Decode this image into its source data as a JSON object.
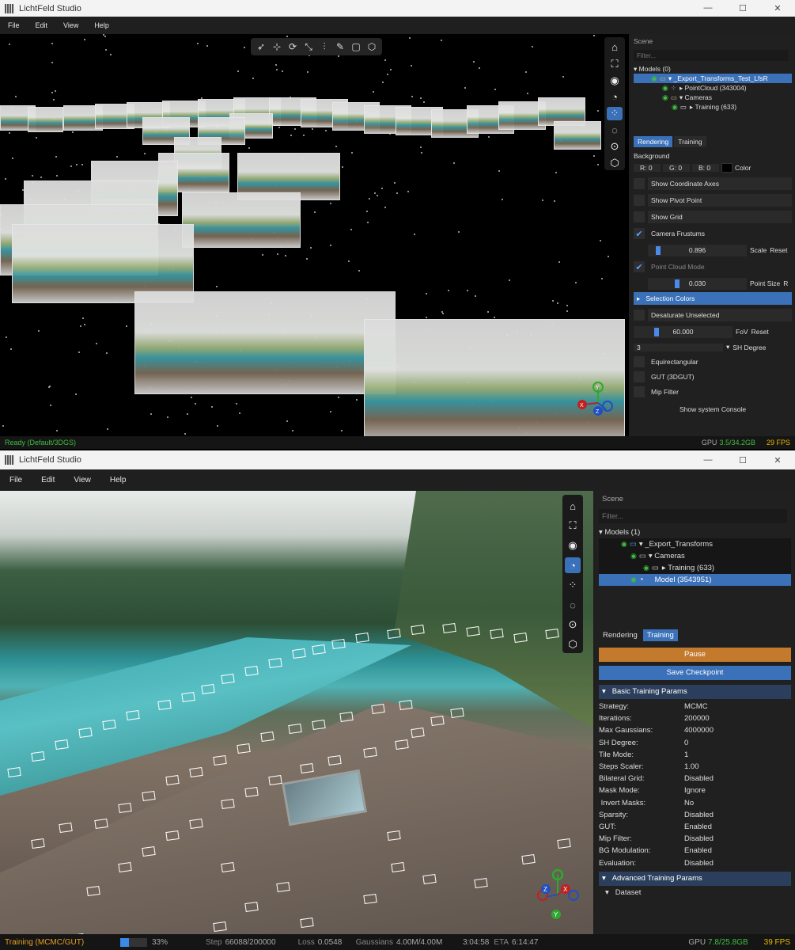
{
  "top": {
    "title": "LichtFeld Studio",
    "window_controls": [
      "—",
      "☐",
      "✕"
    ],
    "menu": [
      "File",
      "Edit",
      "View",
      "Help"
    ],
    "toolbar_icons": [
      "pointer-icon",
      "translate-icon",
      "rotate-icon",
      "scale-icon",
      "mirror-icon",
      "brush-icon",
      "crop-icon",
      "cube-icon"
    ],
    "side_icons": [
      "home-icon",
      "fit-icon",
      "eye-icon",
      "splat-icon",
      "points-icon",
      "select-circle-icon",
      "select-dashed-icon",
      "cube-icon"
    ],
    "scene": {
      "title": "Scene",
      "filter_placeholder": "Filter...",
      "models_label": "Models (0)",
      "tree": [
        {
          "label": "_Export_Transforms_Test_LfsR"
        },
        {
          "label": "PointCloud  (343004)"
        },
        {
          "label": "Cameras"
        },
        {
          "label": "Training (633)"
        }
      ]
    },
    "tabs": [
      "Rendering",
      "Training"
    ],
    "background_label": "Background",
    "rgb": [
      "R: 0",
      "G: 0",
      "B: 0"
    ],
    "color_label": "Color",
    "options": [
      {
        "label": "Show Coordinate Axes",
        "checked": false
      },
      {
        "label": "Show Pivot Point",
        "checked": false
      },
      {
        "label": "Show Grid",
        "checked": false
      },
      {
        "label": "Camera Frustums",
        "checked": true
      }
    ],
    "scale_value": "0.896",
    "scale_label": "Scale",
    "reset_label": "Reset",
    "point_cloud_mode": "Point Cloud Mode",
    "point_size_value": "0.030",
    "point_size_label": "Point Size",
    "point_size_reset": "R",
    "selection_colors": "Selection Colors",
    "desaturate": "Desaturate Unselected",
    "fov_value": "60.000",
    "fov_label": "FoV",
    "fov_reset": "Reset",
    "sh_value": "3",
    "sh_label": "SH Degree",
    "options2": [
      "Equirectangular",
      "GUT (3DGUT)",
      "Mip Filter"
    ],
    "console_btn": "Show system Console",
    "status_left": "Ready (Default/3DGS)",
    "gpu_label": "GPU",
    "gpu_value": "3.5/34.2GB",
    "fps": "29 FPS",
    "gizmo": [
      "Y",
      "X",
      "Z"
    ]
  },
  "bottom": {
    "title": "LichtFeld Studio",
    "window_controls": [
      "—",
      "☐",
      "✕"
    ],
    "menu": [
      "File",
      "Edit",
      "View",
      "Help"
    ],
    "side_icons": [
      "home-icon",
      "fit-icon",
      "eye-icon",
      "splat-icon",
      "points-icon",
      "select-circle-icon",
      "select-dashed-icon",
      "cube-icon"
    ],
    "scene": {
      "title": "Scene",
      "filter_placeholder": "Filter...",
      "models_label": "Models (1)",
      "tree": [
        {
          "label": "_Export_Transforms"
        },
        {
          "label": "Cameras"
        },
        {
          "label": "Training (633)"
        },
        {
          "label": "Model  (3543951)"
        }
      ]
    },
    "tabs": [
      "Rendering",
      "Training"
    ],
    "pause": "Pause",
    "save_checkpoint": "Save Checkpoint",
    "basic_header": "Basic Training Params",
    "params": [
      {
        "k": "Strategy:",
        "v": "MCMC"
      },
      {
        "k": "Iterations:",
        "v": "200000"
      },
      {
        "k": "Max Gaussians:",
        "v": "4000000"
      },
      {
        "k": "SH Degree:",
        "v": "0"
      },
      {
        "k": "Tile Mode:",
        "v": "1"
      },
      {
        "k": "Steps Scaler:",
        "v": "1.00"
      },
      {
        "k": "Bilateral Grid:",
        "v": "Disabled"
      },
      {
        "k": "Mask Mode:",
        "v": "Ignore"
      },
      {
        "k": " Invert Masks:",
        "v": "No"
      },
      {
        "k": "Sparsity:",
        "v": "Disabled"
      },
      {
        "k": "GUT:",
        "v": "Enabled"
      },
      {
        "k": "Mip Filter:",
        "v": "Disabled"
      },
      {
        "k": "BG Modulation:",
        "v": "Enabled"
      },
      {
        "k": "Evaluation:",
        "v": "Disabled"
      }
    ],
    "advanced_header": "Advanced Training Params",
    "dataset": "Dataset",
    "status": {
      "mode": "Training (MCMC/GUT)",
      "progress": 0.33,
      "progress_text": "33%",
      "step_label": "Step",
      "step": "66088/200000",
      "loss_label": "Loss",
      "loss": "0.0548",
      "gauss_label": "Gaussians",
      "gauss": "4.00M/4.00M",
      "time": "3:04:58",
      "eta_label": "ETA",
      "eta": "6:14:47",
      "gpu_label": "GPU",
      "gpu": "7.8/25.8GB",
      "fps": "39 FPS"
    },
    "gizmo": [
      "Y",
      "X",
      "Z"
    ]
  },
  "colors": {
    "accent": "#3a71b8",
    "pause": "#c47a2c",
    "status_green": "#3fbf3f",
    "fps_yellow": "#e6b800"
  }
}
